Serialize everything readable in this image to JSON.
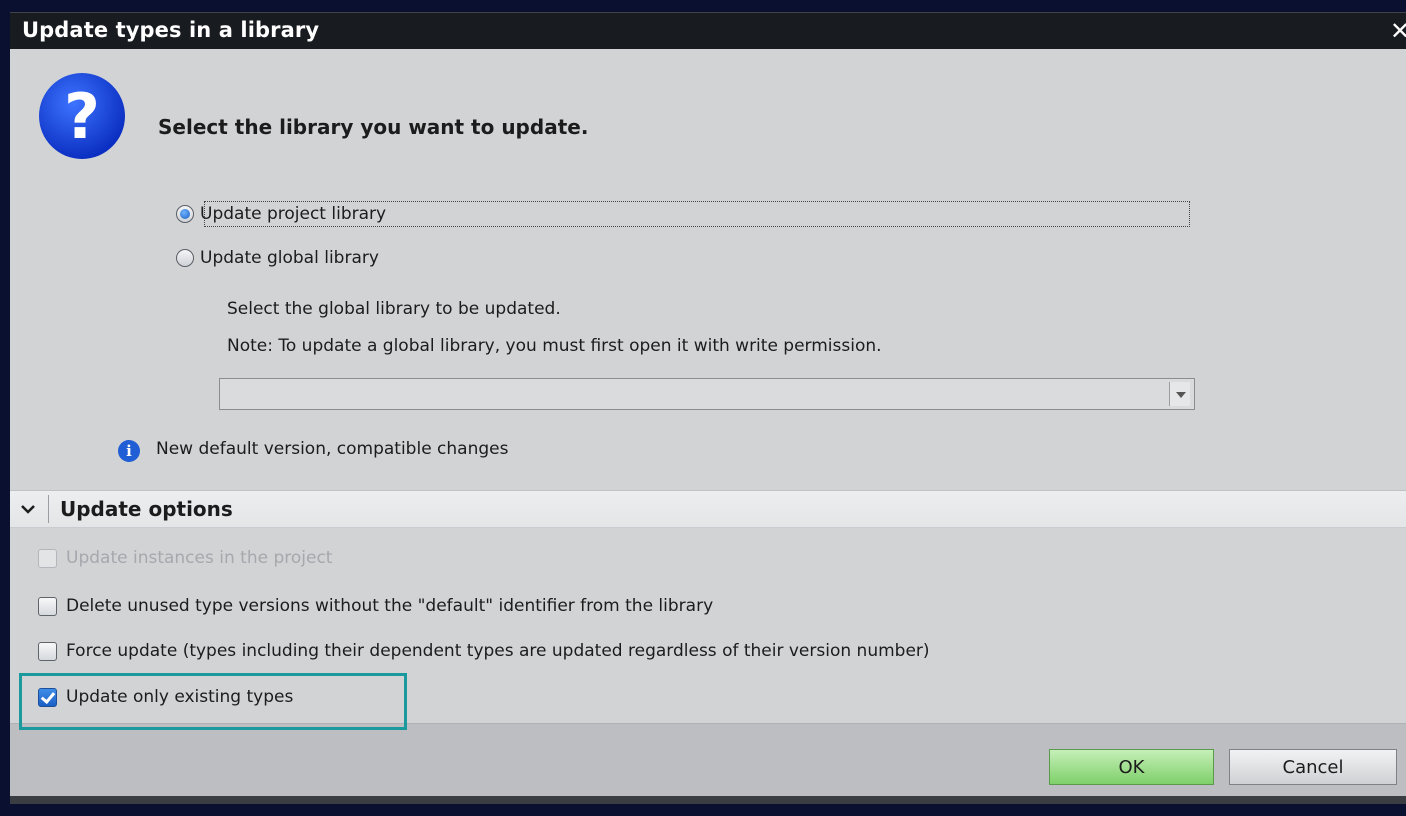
{
  "window": {
    "title": "Update types in a library",
    "close_glyph": "✕"
  },
  "prompt": {
    "icon": "question-icon",
    "heading": "Select the library you want to update."
  },
  "library_choice": {
    "options": [
      {
        "label": "Update project library",
        "selected": true
      },
      {
        "label": "Update global library",
        "selected": false
      }
    ],
    "global_hint_1": "Select the global library to be updated.",
    "global_hint_2": "Note: To update a global library, you must first open it with write permission.",
    "global_dropdown_value": ""
  },
  "info": {
    "icon": "info-icon",
    "text": "New default version, compatible changes"
  },
  "update_options": {
    "title": "Update options",
    "items": [
      {
        "label": "Update instances in the project",
        "checked": false,
        "disabled": true
      },
      {
        "label": "Delete unused type versions without the \"default\" identifier from the library",
        "checked": false,
        "disabled": false
      },
      {
        "label": "Force update (types including their dependent types are updated regardless of their version number)",
        "checked": false,
        "disabled": false
      },
      {
        "label": "Update only existing types",
        "checked": true,
        "disabled": false
      }
    ]
  },
  "buttons": {
    "ok": "OK",
    "cancel": "Cancel"
  },
  "colors": {
    "highlight": "#1a9a9c",
    "ok_button": "#7fd06a",
    "title_bar": "#181b1f"
  }
}
